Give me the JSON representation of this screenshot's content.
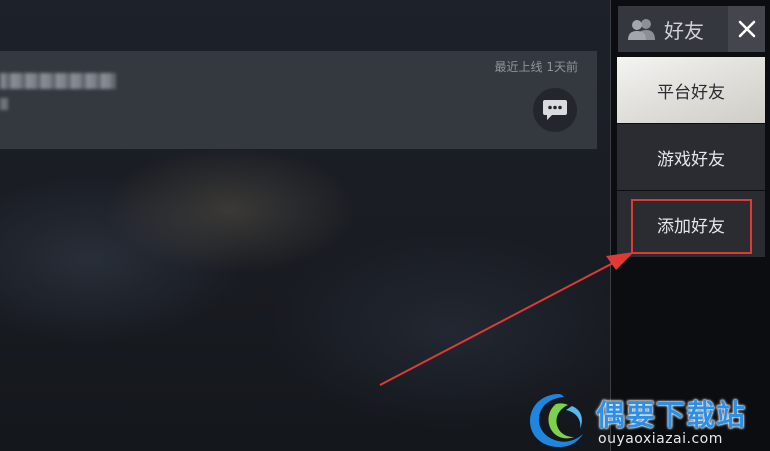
{
  "friend_card": {
    "last_online": "最近上线 1天前"
  },
  "panel": {
    "title": "好友",
    "close_symbol": "✕",
    "buttons": [
      {
        "label": "平台好友"
      },
      {
        "label": "游戏好友"
      },
      {
        "label": "添加好友"
      }
    ]
  },
  "watermark": {
    "title": "偶要下载站",
    "domain": "ouyaoxiazai.com"
  },
  "colors": {
    "highlight": "#e03a34",
    "watermark_blue": "#2d8fe6"
  },
  "icons": [
    "chat-bubble-icon",
    "friends-icon",
    "close-icon",
    "watermark-logo-icon"
  ]
}
